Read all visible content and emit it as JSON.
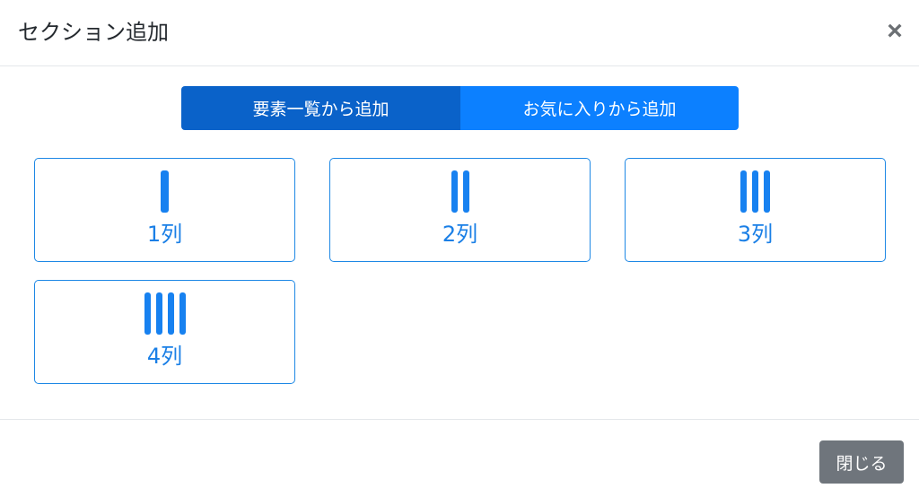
{
  "dialog": {
    "title": "セクション追加",
    "close_icon": "×"
  },
  "tabs": [
    {
      "label": "要素一覧から追加",
      "active": true
    },
    {
      "label": "お気に入りから追加",
      "active": false
    }
  ],
  "layout_options": [
    {
      "label": "1列",
      "columns": 1,
      "icon": "column-bars-icon"
    },
    {
      "label": "2列",
      "columns": 2,
      "icon": "column-bars-icon"
    },
    {
      "label": "3列",
      "columns": 3,
      "icon": "column-bars-icon"
    },
    {
      "label": "4列",
      "columns": 4,
      "icon": "column-bars-icon"
    }
  ],
  "footer": {
    "close_label": "閉じる"
  },
  "colors": {
    "tab_active": "#0a62c9",
    "tab_inactive": "#0c80ff",
    "accent": "#1781f0",
    "footer_button": "#6f757c"
  }
}
